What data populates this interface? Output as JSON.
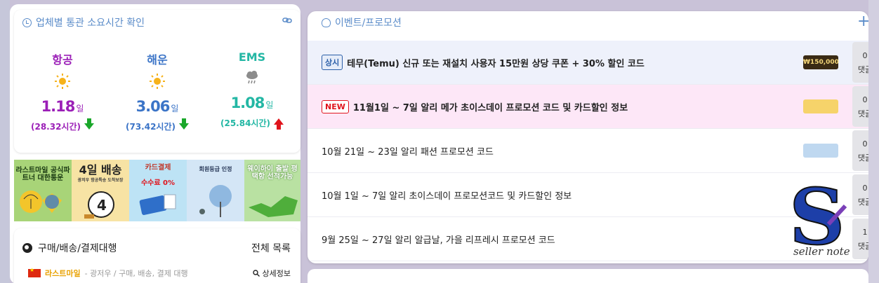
{
  "customs": {
    "title": "업체별 통관 소요시간 확인",
    "columns": [
      {
        "name": "항공",
        "days": "1.18",
        "unit": "일",
        "hours": "(28.32시간)",
        "trend": "down",
        "color": "#9b1fb7",
        "weather": "sun-icon"
      },
      {
        "name": "해운",
        "days": "3.06",
        "unit": "일",
        "hours": "(73.42시간)",
        "trend": "down",
        "color": "#3b74c7",
        "weather": "sun-icon"
      },
      {
        "name": "EMS",
        "days": "1.08",
        "unit": "일",
        "hours": "(25.84시간)",
        "trend": "up",
        "color": "#23b7a4",
        "weather": "rain-cloud-icon"
      }
    ]
  },
  "banners": [
    {
      "text": "라스트마일 공식파트너 대한통운"
    },
    {
      "text": "4일 배송",
      "sub": "광저우 항공특송 도착보장"
    },
    {
      "text": "카드결제",
      "sub": "수수료 0%"
    },
    {
      "text": "회원등급 인정"
    },
    {
      "text": "웨이하이 출발 평택항 선적가능"
    }
  ],
  "buy": {
    "title": "구매/배송/결제대행",
    "more": "전체 목록",
    "vendor": "라스트마일",
    "desc": "- 광저우 / 구매, 배송, 결제 대행",
    "detail": "상세정보"
  },
  "events": {
    "title": "이벤트/프로모션",
    "plus": "+",
    "items": [
      {
        "badge": "상시",
        "title": "테무(Temu) 신규 또는 재설치 사용자 15만원 상당 쿠폰 + 30% 할인 코드",
        "thumb": "₩150,000",
        "count": "0",
        "comment_label": "댓글"
      },
      {
        "badge": "NEW",
        "title": "11월1일 ~ 7일 알리 메가 초이스데이 프로모션 코드 및 카드할인 정보",
        "thumb": "",
        "count": "0",
        "comment_label": "댓글"
      },
      {
        "badge": "",
        "title": "10월 21일 ~ 23일 알리 패션 프로모션 코드",
        "thumb": "",
        "count": "0",
        "comment_label": "댓글"
      },
      {
        "badge": "",
        "title": "10월 1일 ~ 7일 알리 초이스데이 프로모션코드 및 카드할인 정보",
        "thumb": "",
        "count": "0",
        "comment_label": "댓글"
      },
      {
        "badge": "",
        "title": "9월 25일 ~ 27일 알리 알급날, 가을 리프레시 프로모션 코드",
        "thumb": "",
        "count": "1",
        "comment_label": "댓글"
      }
    ]
  },
  "logo": {
    "text": "seller note"
  }
}
